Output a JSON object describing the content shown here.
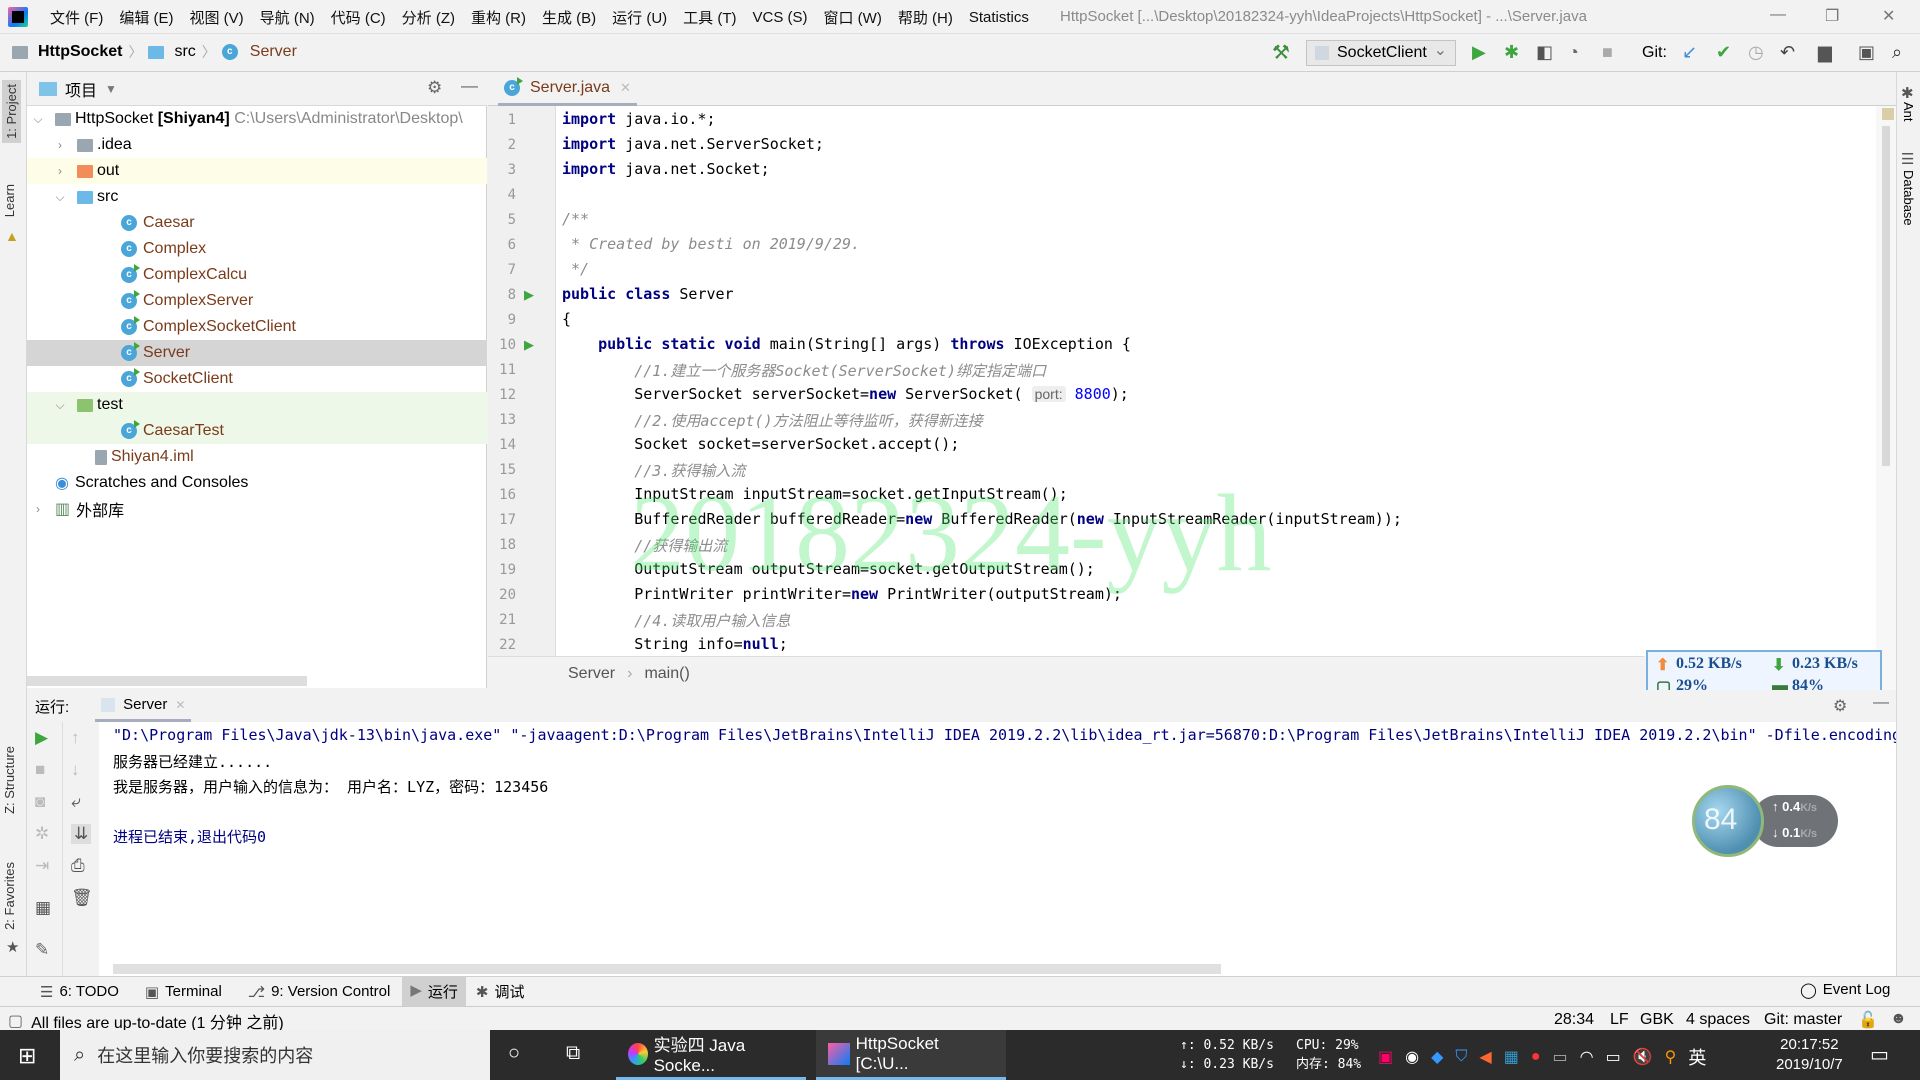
{
  "menubar": {
    "items": [
      "文件 (F)",
      "编辑 (E)",
      "视图 (V)",
      "导航 (N)",
      "代码 (C)",
      "分析 (Z)",
      "重构 (R)",
      "生成 (B)",
      "运行 (U)",
      "工具 (T)",
      "VCS (S)",
      "窗口 (W)",
      "帮助 (H)",
      "Statistics"
    ],
    "window_title": "HttpSocket [...\\Desktop\\20182324-yyh\\IdeaProjects\\HttpSocket] - ...\\Server.java"
  },
  "navbar": {
    "breadcrumbs": [
      "HttpSocket",
      "src",
      "Server"
    ],
    "run_config": "SocketClient",
    "git_label": "Git:"
  },
  "left_stripe": {
    "tabs": [
      "1: Project",
      "Learn",
      "Z: Structure",
      "2: Favorites"
    ]
  },
  "right_stripe": {
    "tabs": [
      "Ant",
      "Database"
    ]
  },
  "project": {
    "header": "项目",
    "root_name": "HttpSocket",
    "root_module": "[Shiyan4]",
    "root_path": "C:\\Users\\Administrator\\Desktop\\",
    "items": [
      {
        "label": ".idea",
        "type": "folder"
      },
      {
        "label": "out",
        "type": "folder-excluded"
      },
      {
        "label": "src",
        "type": "folder-source"
      },
      {
        "label": "Caesar",
        "type": "class"
      },
      {
        "label": "Complex",
        "type": "class"
      },
      {
        "label": "ComplexCalcu",
        "type": "class-run"
      },
      {
        "label": "ComplexServer",
        "type": "class-run"
      },
      {
        "label": "ComplexSocketClient",
        "type": "class-run"
      },
      {
        "label": "Server",
        "type": "class-run",
        "selected": true
      },
      {
        "label": "SocketClient",
        "type": "class-run"
      },
      {
        "label": "test",
        "type": "folder-test"
      },
      {
        "label": "CaesarTest",
        "type": "class-run"
      },
      {
        "label": "Shiyan4.iml",
        "type": "file"
      },
      {
        "label": "Scratches and Consoles",
        "type": "scratch"
      },
      {
        "label": "外部库",
        "type": "library"
      }
    ]
  },
  "editor": {
    "tab": "Server.java",
    "lines": [
      {
        "n": "1",
        "html": "<span class='kw'>import</span> java.io.*;"
      },
      {
        "n": "2",
        "html": "<span class='kw'>import</span> java.net.ServerSocket;"
      },
      {
        "n": "3",
        "html": "<span class='kw'>import</span> java.net.Socket;"
      },
      {
        "n": "4",
        "html": ""
      },
      {
        "n": "5",
        "html": "<span class='cm'>/**</span>"
      },
      {
        "n": "6",
        "html": "<span class='cm'> * Created by besti on 2019/9/29.</span>"
      },
      {
        "n": "7",
        "html": "<span class='cm'> */</span>"
      },
      {
        "n": "8",
        "html": "<span class='kw'>public class</span> Server"
      },
      {
        "n": "9",
        "html": "{"
      },
      {
        "n": "10",
        "html": "    <span class='kw'>public static void</span> main(String[] args) <span class='kw'>throws</span> IOException {"
      },
      {
        "n": "11",
        "html": "        <span class='cm'>//1.建立一个服务器Socket(ServerSocket)绑定指定端口</span>"
      },
      {
        "n": "12",
        "html": "        ServerSocket serverSocket=<span class='kw'>new</span> ServerSocket( <span class='hint'>port:</span> <span class='num'>8800</span>);"
      },
      {
        "n": "13",
        "html": "        <span class='cm'>//2.使用accept()方法阻止等待监听，获得新连接</span>"
      },
      {
        "n": "14",
        "html": "        Socket socket=serverSocket.accept();"
      },
      {
        "n": "15",
        "html": "        <span class='cm'>//3.获得输入流</span>"
      },
      {
        "n": "16",
        "html": "        InputStream inputStream=socket.getInputStream();"
      },
      {
        "n": "17",
        "html": "        BufferedReader bufferedReader=<span class='kw'>new</span> BufferedReader(<span class='kw'>new</span> InputStreamReader(inputStream));"
      },
      {
        "n": "18",
        "html": "        <span class='cm'>//获得输出流</span>"
      },
      {
        "n": "19",
        "html": "        OutputStream outputStream=socket.getOutputStream();"
      },
      {
        "n": "20",
        "html": "        PrintWriter printWriter=<span class='kw'>new</span> PrintWriter(outputStream);"
      },
      {
        "n": "21",
        "html": "        <span class='cm'>//4.读取用户输入信息</span>"
      },
      {
        "n": "22",
        "html": "        String info=<span class='kw'>null</span>;"
      }
    ],
    "watermark": "20182324-yyh",
    "breadcrumb": [
      "Server",
      "main()"
    ]
  },
  "netmon": {
    "up": "0.52 KB/s",
    "down": "0.23 KB/s",
    "cpu": "29%",
    "mem": "84%"
  },
  "globe_widget": {
    "percent": "84",
    "up": "0.4",
    "down": "0.1",
    "unit": "K/s"
  },
  "run_panel": {
    "label": "运行:",
    "tab": "Server",
    "console": [
      {
        "text": "\"D:\\Program Files\\Java\\jdk-13\\bin\\java.exe\" \"-javaagent:D:\\Program Files\\JetBrains\\IntelliJ IDEA 2019.2.2\\lib\\idea_rt.jar=56870:D:\\Program Files\\JetBrains\\IntelliJ IDEA 2019.2.2\\bin\" -Dfile.encoding",
        "color": "#000080"
      },
      {
        "text": "服务器已经建立......",
        "color": "#000"
      },
      {
        "text": "我是服务器，用户输入的信息为： 用户名：LYZ，密码：123456",
        "color": "#000"
      },
      {
        "text": "",
        "color": "#000"
      },
      {
        "text": "进程已结束,退出代码0",
        "color": "#000080"
      }
    ]
  },
  "tool_tabs": [
    "6: TODO",
    "Terminal",
    "9: Version Control",
    "运行",
    "调试"
  ],
  "event_log": "Event Log",
  "status": {
    "message": "All files are up-to-date (1 分钟 之前)",
    "position": "28:34",
    "line_sep": "LF",
    "encoding": "GBK",
    "indent": "4 spaces",
    "git": "Git: master"
  },
  "taskbar": {
    "search_placeholder": "在这里输入你要搜索的内容",
    "apps": [
      "实验四 Java Socke...",
      "HttpSocket [C:\\U..."
    ],
    "net_up": "↑: 0.52 KB/s",
    "net_down": "↓: 0.23 KB/s",
    "cpu": "CPU: 29%",
    "mem": "内存: 84%",
    "ime": "英",
    "time": "20:17:52",
    "date": "2019/10/7"
  }
}
